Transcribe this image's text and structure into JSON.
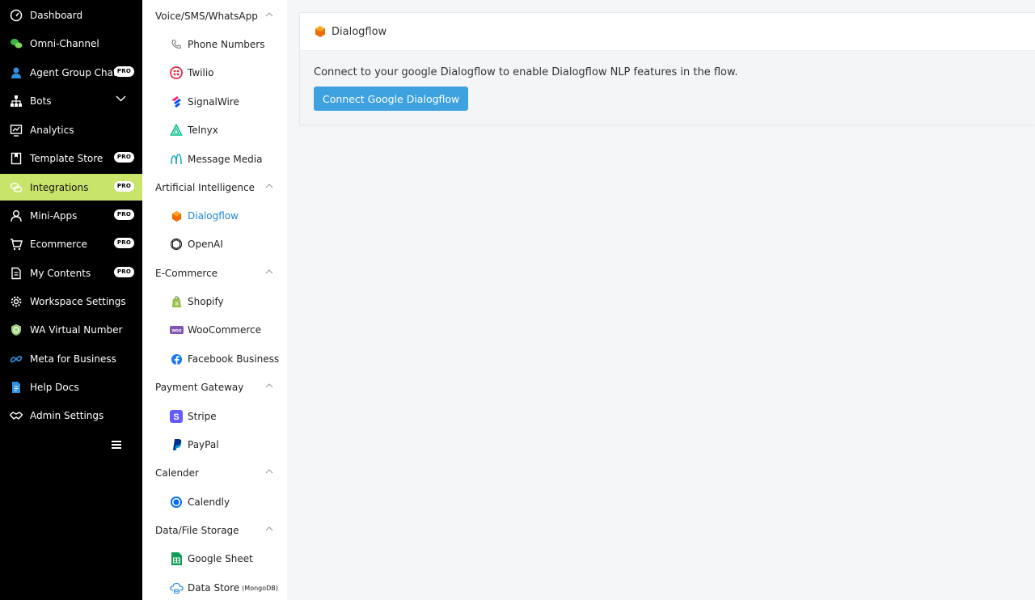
{
  "sidebar": {
    "items": [
      {
        "label": "Dashboard",
        "icon": "dashboard-icon",
        "pro": false
      },
      {
        "label": "Omni-Channel",
        "icon": "chat-bubbles-icon",
        "pro": false
      },
      {
        "label": "Agent Group Chat",
        "icon": "agent-icon",
        "pro": true
      },
      {
        "label": "Bots",
        "icon": "bots-tree-icon",
        "pro": false
      },
      {
        "label": "Analytics",
        "icon": "analytics-icon",
        "pro": false
      },
      {
        "label": "Template Store",
        "icon": "template-icon",
        "pro": true
      },
      {
        "label": "Integrations",
        "icon": "integrations-icon",
        "pro": true
      },
      {
        "label": "Mini-Apps",
        "icon": "user-icon",
        "pro": true
      },
      {
        "label": "Ecommerce",
        "icon": "cart-icon",
        "pro": true
      },
      {
        "label": "My Contents",
        "icon": "document-icon",
        "pro": true
      },
      {
        "label": "Workspace Settings",
        "icon": "gear-icon",
        "pro": false
      },
      {
        "label": "WA Virtual Number",
        "icon": "shield-icon",
        "pro": false
      },
      {
        "label": "Meta for Business",
        "icon": "meta-icon",
        "pro": false
      },
      {
        "label": "Help Docs",
        "icon": "docs-icon",
        "pro": false
      },
      {
        "label": "Admin Settings",
        "icon": "handshake-icon",
        "pro": false
      }
    ],
    "pro_badge": "PRO",
    "active": "Integrations"
  },
  "submenu": {
    "sections": [
      {
        "title": "Voice/SMS/WhatsApp",
        "items": [
          "Phone Numbers",
          "Twilio",
          "SignalWire",
          "Telnyx",
          "Message Media"
        ]
      },
      {
        "title": "Artificial Intelligence",
        "items": [
          "Dialogflow",
          "OpenAI"
        ]
      },
      {
        "title": "E-Commerce",
        "items": [
          "Shopify",
          "WooCommerce",
          "Facebook Business"
        ]
      },
      {
        "title": "Payment Gateway",
        "items": [
          "Stripe",
          "PayPal"
        ]
      },
      {
        "title": "Calender",
        "items": [
          "Calendly"
        ]
      },
      {
        "title": "Data/File Storage",
        "items": [
          "Google Sheet",
          "Data Store"
        ]
      }
    ],
    "data_store_suffix": "(MongoDB)",
    "active": "Dialogflow"
  },
  "main": {
    "card_title": "Dialogflow",
    "description": "Connect to your google Dialogflow to enable Dialogflow NLP features in the flow.",
    "button_label": "Connect Google Dialogflow"
  },
  "colors": {
    "sidebar_bg": "#000000",
    "active_nav": "#c8e46a",
    "active_sub": "#1e86d8",
    "button": "#3ea2e0",
    "page_bg": "#f5f6f8"
  }
}
